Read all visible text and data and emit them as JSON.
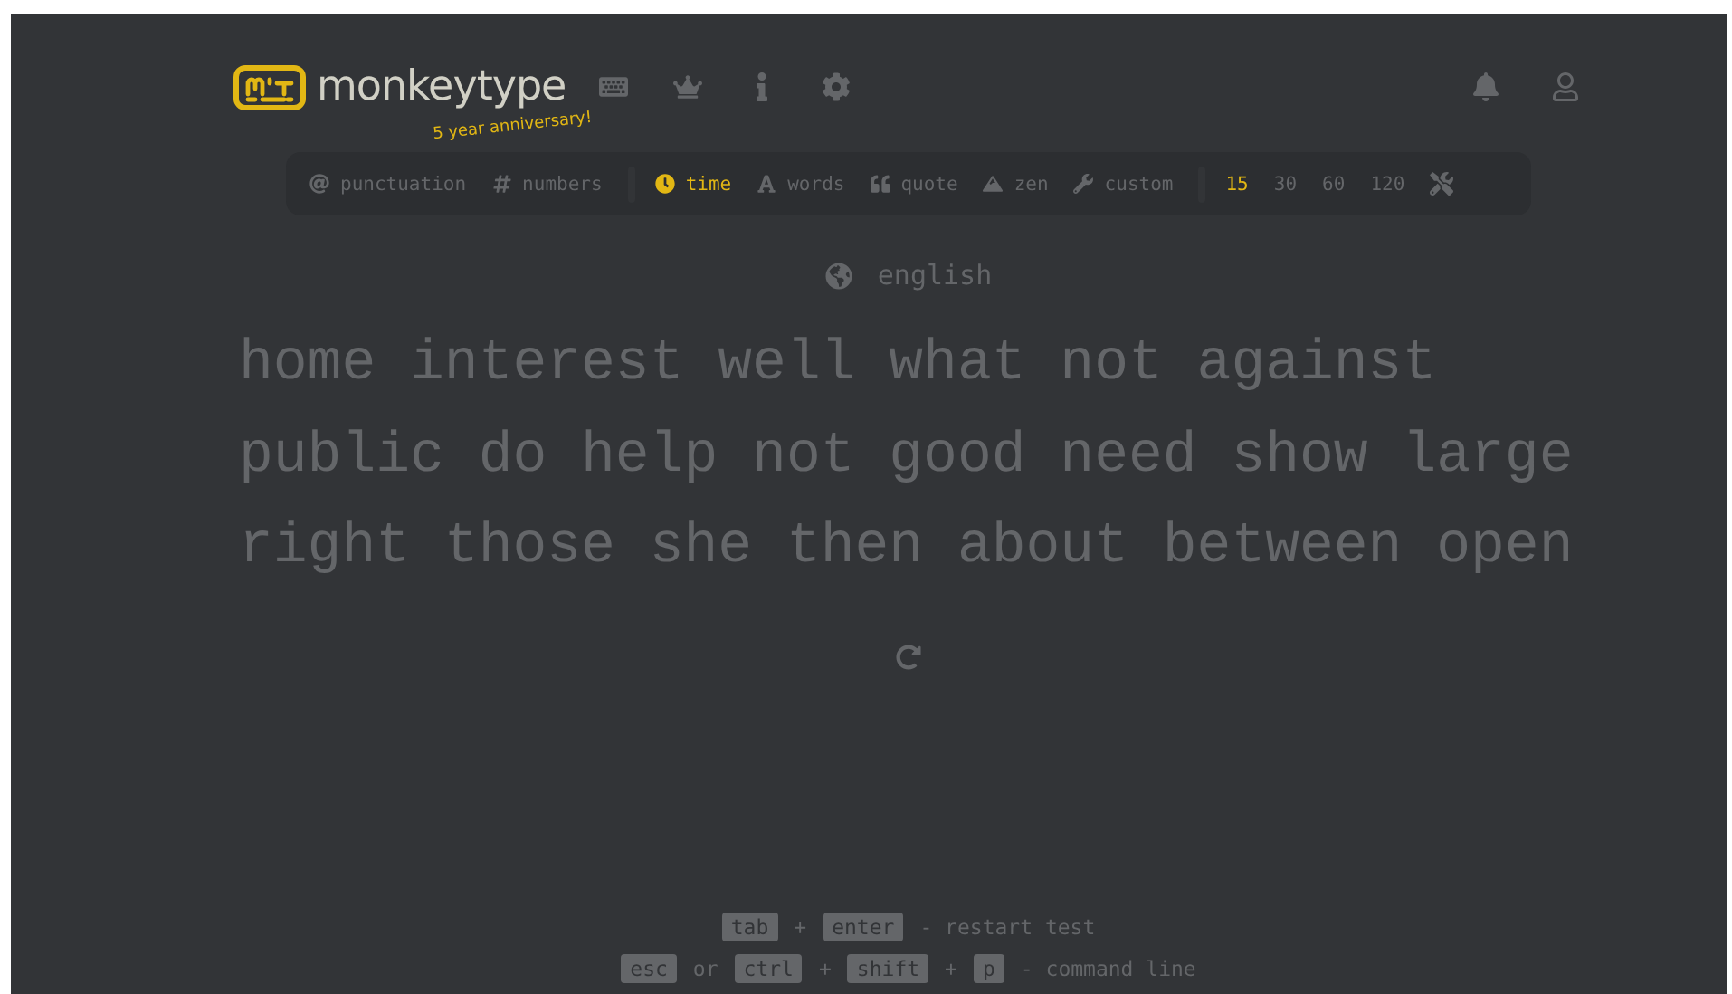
{
  "logo": {
    "title": "monkeytype",
    "subtitle": "5 year anniversary!"
  },
  "config_bar": {
    "groups": [
      {
        "items": [
          {
            "label": "punctuation",
            "selected": false
          },
          {
            "label": "numbers",
            "selected": false
          }
        ]
      },
      {
        "items": [
          {
            "label": "time",
            "selected": true
          },
          {
            "label": "words",
            "selected": false
          },
          {
            "label": "quote",
            "selected": false
          },
          {
            "label": "zen",
            "selected": false
          },
          {
            "label": "custom",
            "selected": false
          }
        ]
      },
      {
        "items": [
          {
            "label": "15",
            "selected": true
          },
          {
            "label": "30",
            "selected": false
          },
          {
            "label": "60",
            "selected": false
          },
          {
            "label": "120",
            "selected": false
          }
        ]
      }
    ]
  },
  "language": "english",
  "words": [
    "home interest well what not against",
    "public do help not good need show large",
    "right those she then about between open"
  ],
  "footer": [
    [
      {
        "kind": "key",
        "text": "tab"
      },
      {
        "kind": "text",
        "text": "+"
      },
      {
        "kind": "key",
        "text": "enter"
      },
      {
        "kind": "text",
        "text": "- restart test"
      }
    ],
    [
      {
        "kind": "key",
        "text": "esc"
      },
      {
        "kind": "text",
        "text": "or"
      },
      {
        "kind": "key",
        "text": "ctrl"
      },
      {
        "kind": "text",
        "text": "+"
      },
      {
        "kind": "key",
        "text": "shift"
      },
      {
        "kind": "text",
        "text": "+"
      },
      {
        "kind": "key",
        "text": "p"
      },
      {
        "kind": "text",
        "text": "- command line"
      }
    ]
  ]
}
